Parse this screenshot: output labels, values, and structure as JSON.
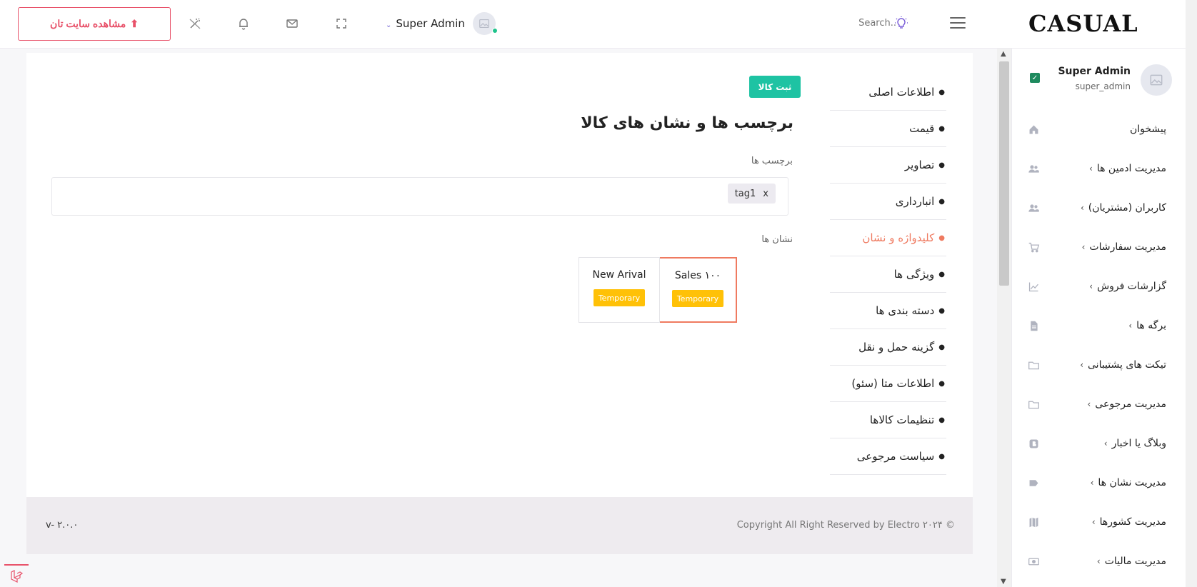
{
  "header": {
    "visit_site_label": "مشاهده سایت تان",
    "user_name": "Super Admin",
    "search_placeholder": "Search..",
    "logo_text": "CASUAL"
  },
  "sidebar": {
    "profile_name": "Super Admin",
    "profile_username": "super_admin",
    "items": [
      {
        "label": "پیشخوان",
        "icon": "home-icon",
        "has_arrow": false
      },
      {
        "label": "مدیریت ادمین ها",
        "icon": "users-icon",
        "has_arrow": true
      },
      {
        "label": "کاربران (مشتریان)",
        "icon": "users-icon",
        "has_arrow": true
      },
      {
        "label": "مدیریت سفارشات",
        "icon": "cart-icon",
        "has_arrow": true
      },
      {
        "label": "گزارشات فروش",
        "icon": "chart-line-icon",
        "has_arrow": true
      },
      {
        "label": "برگه ها",
        "icon": "file-icon",
        "has_arrow": true
      },
      {
        "label": "تیکت های پشتیبانی",
        "icon": "folder-icon",
        "has_arrow": true
      },
      {
        "label": "مدیریت مرجوعی",
        "icon": "folder-icon",
        "has_arrow": true
      },
      {
        "label": "وبلاگ یا اخبار",
        "icon": "blog-icon",
        "has_arrow": true
      },
      {
        "label": "مدیریت نشان ها",
        "icon": "tag-icon",
        "has_arrow": true
      },
      {
        "label": "مدیریت کشورها",
        "icon": "map-icon",
        "has_arrow": true
      },
      {
        "label": "مدیریت مالیات",
        "icon": "money-icon",
        "has_arrow": true
      }
    ]
  },
  "form": {
    "steps": [
      "اطلاعات اصلی",
      "قیمت",
      "تصاویر",
      "انبارداری",
      "کلیدواژه و نشان",
      "ویژگی ها",
      "دسته بندی ها",
      "گزینه حمل و نقل",
      "اطلاعات متا (سئو)",
      "تنظیمات کالاها",
      "سیاست مرجوعی"
    ],
    "active_step": 4,
    "submit_label": "ثبت کالا",
    "title": "برچسب ها و نشان های کالا",
    "tags_label": "برچسب ها",
    "tags": [
      "tag1"
    ],
    "tag_remove": "x",
    "badges_label": "نشان ها",
    "badges": [
      {
        "title": "Sales ۱۰۰",
        "type": "Temporary",
        "selected": true
      },
      {
        "title": "New Arival",
        "type": "Temporary",
        "selected": false
      }
    ]
  },
  "footer": {
    "copyright": "© Copyright All Right Reserved by Electro ۲۰۲۴",
    "version": "v- ۲.۰.۰"
  },
  "colors": {
    "accent": "#ef7a60",
    "primary_button": "#1ec3a3",
    "visit_button": "#e8526a",
    "badge_pill": "#ffc107"
  }
}
